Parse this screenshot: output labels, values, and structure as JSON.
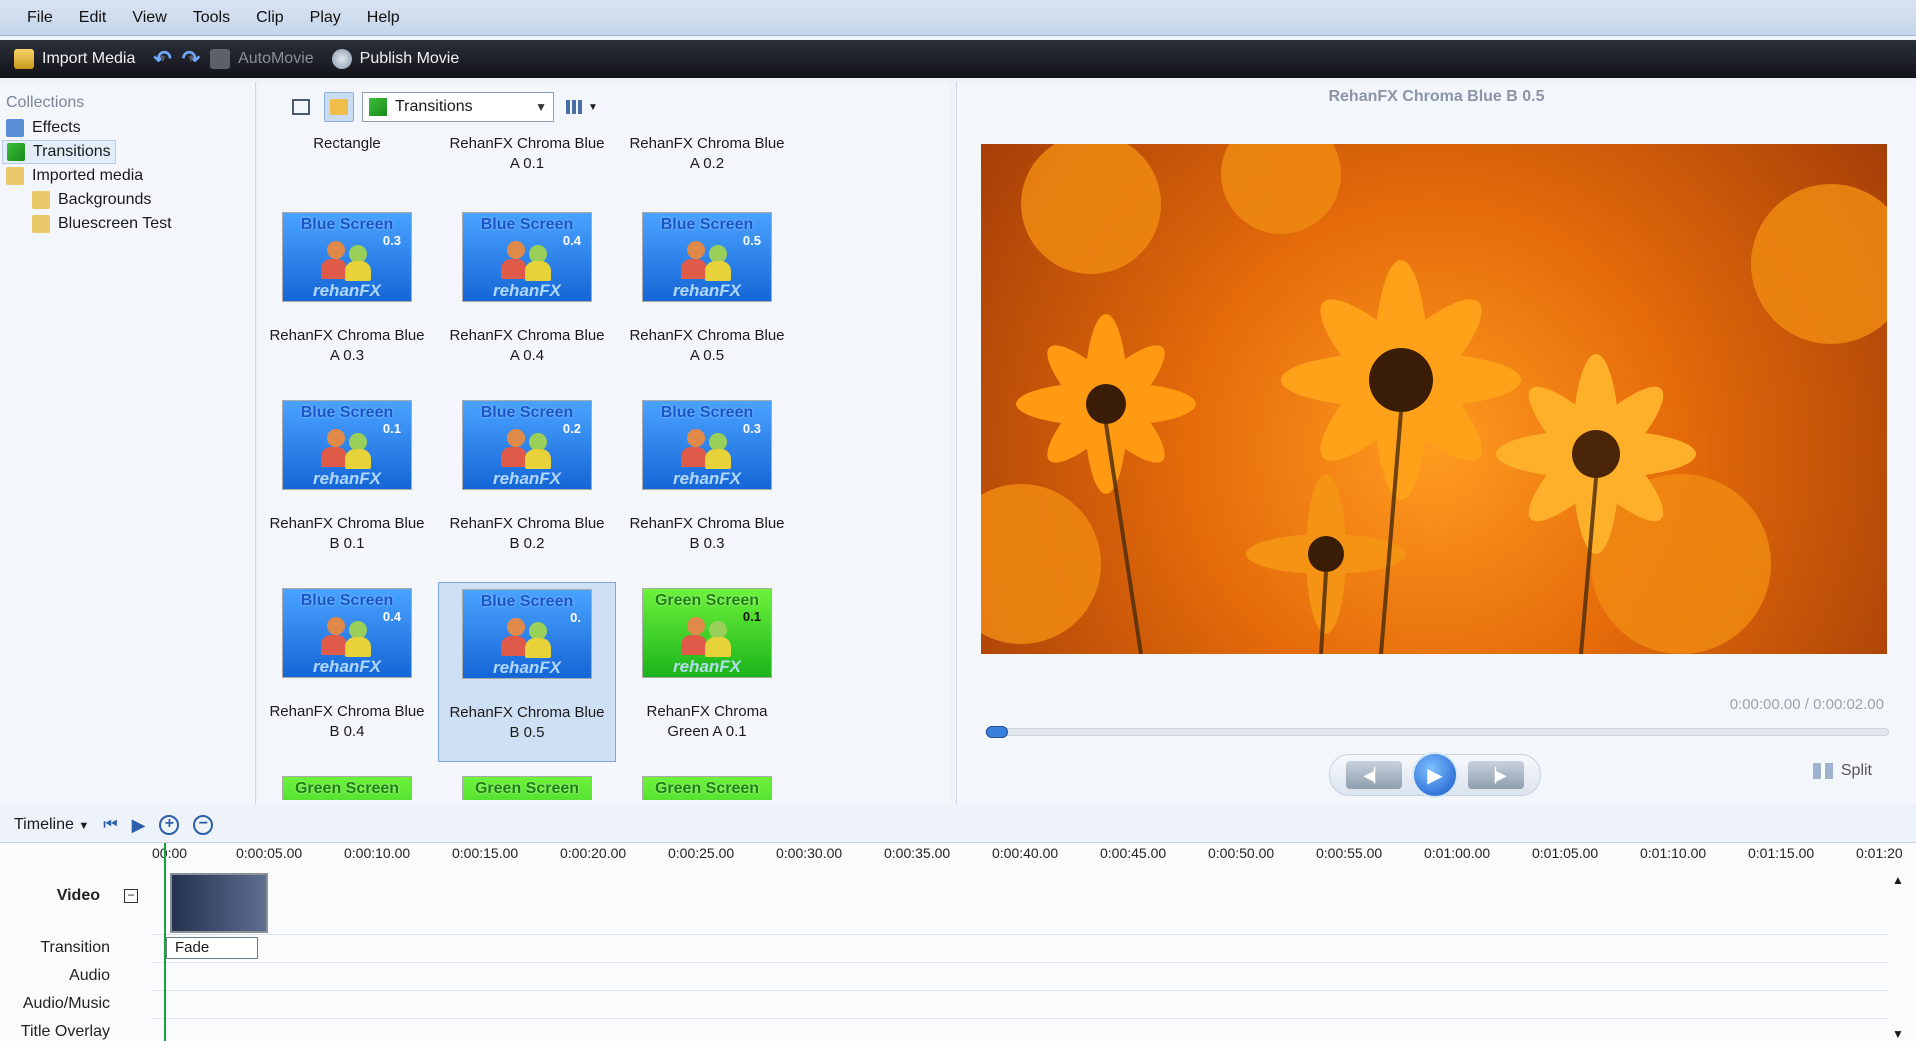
{
  "menu": [
    "File",
    "Edit",
    "View",
    "Tools",
    "Clip",
    "Play",
    "Help"
  ],
  "toolbar": {
    "import_media": "Import Media",
    "automovie": "AutoMovie",
    "publish_movie": "Publish Movie"
  },
  "collections": {
    "header": "Collections",
    "items": [
      {
        "label": "Effects",
        "icon": "star-icon"
      },
      {
        "label": "Transitions",
        "icon": "transition-icon",
        "selected": true
      },
      {
        "label": "Imported media",
        "icon": "folder-icon"
      },
      {
        "label": "Backgrounds",
        "icon": "folder-icon"
      },
      {
        "label": "Bluescreen Test",
        "icon": "folder-icon"
      }
    ]
  },
  "content": {
    "category": "Transitions",
    "items": [
      {
        "label": "Rectangle",
        "kind": "none"
      },
      {
        "label": "RehanFX Chroma Blue A 0.1",
        "kind": "none"
      },
      {
        "label": "RehanFX Chroma Blue A 0.2",
        "kind": "none"
      },
      {
        "label": "RehanFX Chroma Blue A 0.3",
        "kind": "blue",
        "title": "Blue Screen",
        "ver": "0.3",
        "brand": "rehanFX"
      },
      {
        "label": "RehanFX Chroma Blue A 0.4",
        "kind": "blue",
        "title": "Blue Screen",
        "ver": "0.4",
        "brand": "rehanFX"
      },
      {
        "label": "RehanFX Chroma Blue A 0.5",
        "kind": "blue",
        "title": "Blue Screen",
        "ver": "0.5",
        "brand": "rehanFX"
      },
      {
        "label": "RehanFX Chroma Blue B 0.1",
        "kind": "blue",
        "title": "Blue Screen",
        "ver": "0.1",
        "brand": "rehanFX"
      },
      {
        "label": "RehanFX Chroma Blue B 0.2",
        "kind": "blue",
        "title": "Blue Screen",
        "ver": "0.2",
        "brand": "rehanFX"
      },
      {
        "label": "RehanFX Chroma Blue B 0.3",
        "kind": "blue",
        "title": "Blue Screen",
        "ver": "0.3",
        "brand": "rehanFX"
      },
      {
        "label": "RehanFX Chroma Blue B 0.4",
        "kind": "blue",
        "title": "Blue Screen",
        "ver": "0.4",
        "brand": "rehanFX"
      },
      {
        "label": "RehanFX Chroma Blue B 0.5",
        "kind": "blue",
        "title": "Blue Screen",
        "ver": "0.",
        "brand": "rehanFX",
        "selected": true
      },
      {
        "label": "RehanFX Chroma Green A 0.1",
        "kind": "green",
        "title": "Green Screen",
        "ver": "0.1",
        "brand": "rehanFX"
      },
      {
        "label": "",
        "kind": "green",
        "title": "Green Screen",
        "ver": "",
        "brand": ""
      },
      {
        "label": "",
        "kind": "green",
        "title": "Green Screen",
        "ver": "",
        "brand": ""
      },
      {
        "label": "",
        "kind": "green",
        "title": "Green Screen",
        "ver": "",
        "brand": ""
      }
    ]
  },
  "preview": {
    "title": "RehanFX Chroma Blue B 0.5",
    "time": "0:00:00.00 / 0:00:02.00",
    "progress": 0.0,
    "split_label": "Split"
  },
  "timeline": {
    "label": "Timeline",
    "ticks": [
      "00:00",
      "0:00:05.00",
      "0:00:10.00",
      "0:00:15.00",
      "0:00:20.00",
      "0:00:25.00",
      "0:00:30.00",
      "0:00:35.00",
      "0:00:40.00",
      "0:00:45.00",
      "0:00:50.00",
      "0:00:55.00",
      "0:01:00.00",
      "0:01:05.00",
      "0:01:10.00",
      "0:01:15.00",
      "0:01:20"
    ],
    "tracks": [
      "Video",
      "Transition",
      "Audio",
      "Audio/Music",
      "Title Overlay"
    ],
    "transition_clip": "Fade"
  },
  "colors": {
    "accent": "#2b73d6",
    "playhead": "#16a33a",
    "toolbar_bg": "#1a1d22"
  }
}
